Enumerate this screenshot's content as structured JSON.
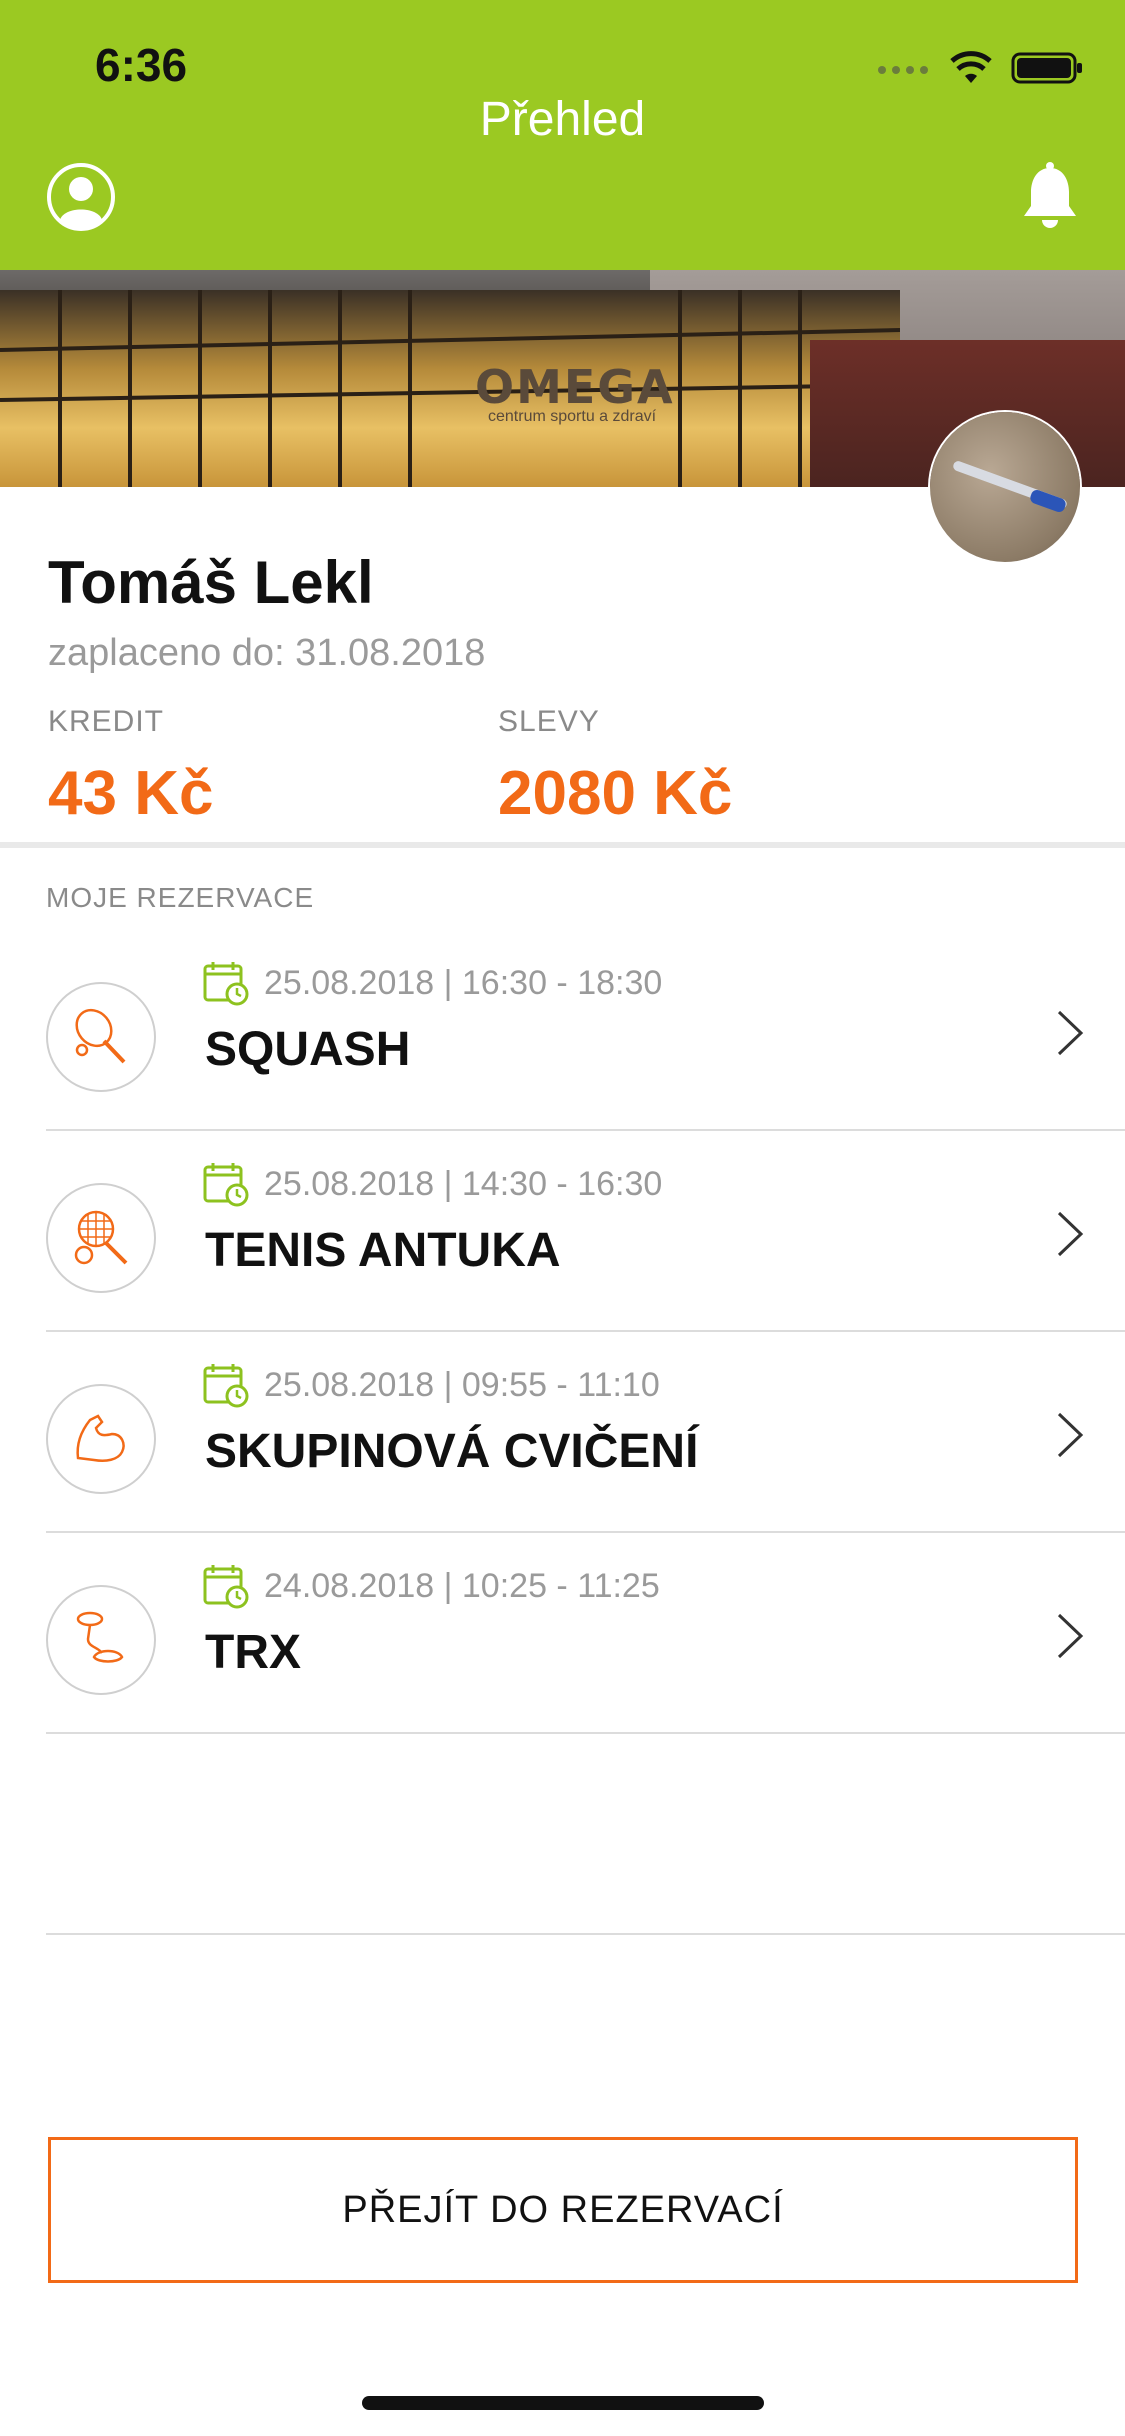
{
  "status_bar": {
    "time": "6:36"
  },
  "header": {
    "title": "Přehled",
    "profile_icon": "person-circle-icon",
    "notification_icon": "bell-icon"
  },
  "banner": {
    "brand": "OMEGA",
    "brand_sub": "centrum sportu a zdraví"
  },
  "profile": {
    "name": "Tomáš Lekl",
    "paid_until": "zaplaceno do: 31.08.2018",
    "credit_label": "KREDIT",
    "credit_value": "43 Kč",
    "discounts_label": "SLEVY",
    "discounts_value": "2080 Kč"
  },
  "reservations": {
    "section_title": "MOJE REZERVACE",
    "items": [
      {
        "date": "25.08.2018 | 16:30 - 18:30",
        "name": "SQUASH",
        "icon": "squash-racket-icon"
      },
      {
        "date": "25.08.2018 | 14:30 - 16:30",
        "name": "TENIS ANTUKA",
        "icon": "tennis-racket-icon"
      },
      {
        "date": "25.08.2018 | 09:55 - 11:10",
        "name": "SKUPINOVÁ CVIČENÍ",
        "icon": "bicep-icon"
      },
      {
        "date": "24.08.2018 | 10:25 - 11:25",
        "name": "TRX",
        "icon": "trx-strap-icon"
      }
    ]
  },
  "cta": {
    "label": "PŘEJÍT DO REZERVACÍ"
  },
  "colors": {
    "header_green": "#9BC922",
    "accent_orange": "#F26A17",
    "calendar_green": "#8DC21F"
  }
}
